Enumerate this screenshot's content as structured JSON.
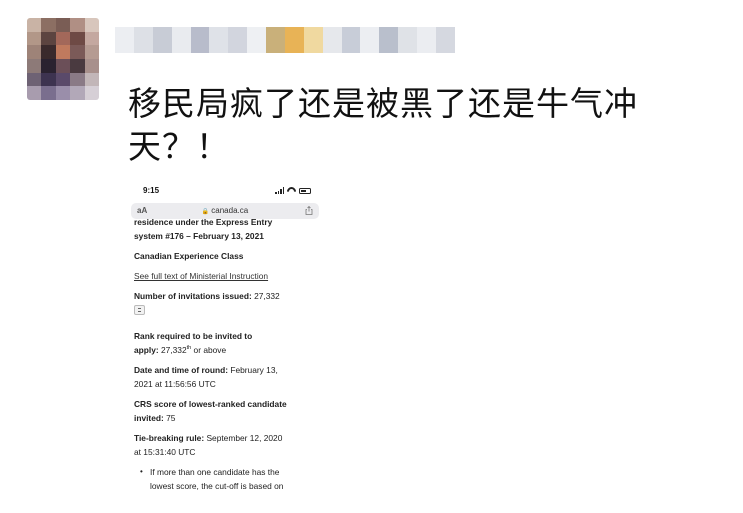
{
  "post": {
    "text": "移民局疯了还是被黑了还是牛气冲天？！"
  },
  "colors": {
    "avatar": [
      "#c9b3a5",
      "#8c6f63",
      "#7a5d55",
      "#b08f84",
      "#d8c6bc",
      "#b29788",
      "#5c4440",
      "#a3685a",
      "#6e4a45",
      "#c4a8a0",
      "#9e8378",
      "#3a2a2c",
      "#c07a5e",
      "#7b5a58",
      "#b59b92",
      "#8d7a78",
      "#2a2230",
      "#6b4f58",
      "#4a3a40",
      "#a8908c",
      "#6e6274",
      "#3d3350",
      "#5a4a6a",
      "#8a7a86",
      "#c2b6b8",
      "#a89cae",
      "#7a6e8e",
      "#9a8eaa",
      "#b2a8b8",
      "#d6cfd6"
    ],
    "username": [
      "#eceef2",
      "#dde0e6",
      "#c8ccd6",
      "#e9ebef",
      "#b8bccb",
      "#dfe2e8",
      "#d2d5de",
      "#eef0f3",
      "#c9b07a",
      "#e8b356",
      "#f0d9a0",
      "#e6e8ec",
      "#c8cdd8",
      "#eceef2",
      "#b9bfcc",
      "#dfe2e7",
      "#ebedf1",
      "#d5d8e0"
    ]
  },
  "phone": {
    "status": {
      "time": "9:15"
    },
    "browser": {
      "url": "canada.ca",
      "reader_icon": "aA"
    },
    "content": {
      "heading_line1": "residence under the Express Entry",
      "heading_line2": "system #176 – February 13, 2021",
      "program": "Canadian Experience Class",
      "link": "See full text of Ministerial Instruction",
      "invitations_label": "Number of invitations issued:",
      "invitations_value": "27,332",
      "rank_label_1": "Rank required to be invited to",
      "rank_label_2": "apply:",
      "rank_value": "27,332",
      "rank_sup": "th",
      "rank_suffix": "or above",
      "date_label": "Date and time of round:",
      "date_value_1": "February 13,",
      "date_value_2": "2021 at 11:56:56 UTC",
      "crs_label_1": "CRS score of lowest-ranked candidate",
      "crs_label_2": "invited:",
      "crs_value": "75",
      "tie_label": "Tie-breaking rule:",
      "tie_value_1": "September 12, 2020",
      "tie_value_2": "at 15:31:40 UTC",
      "bullet_1": "If more than one candidate has the",
      "bullet_2": "lowest score, the cut-off is based on"
    }
  }
}
